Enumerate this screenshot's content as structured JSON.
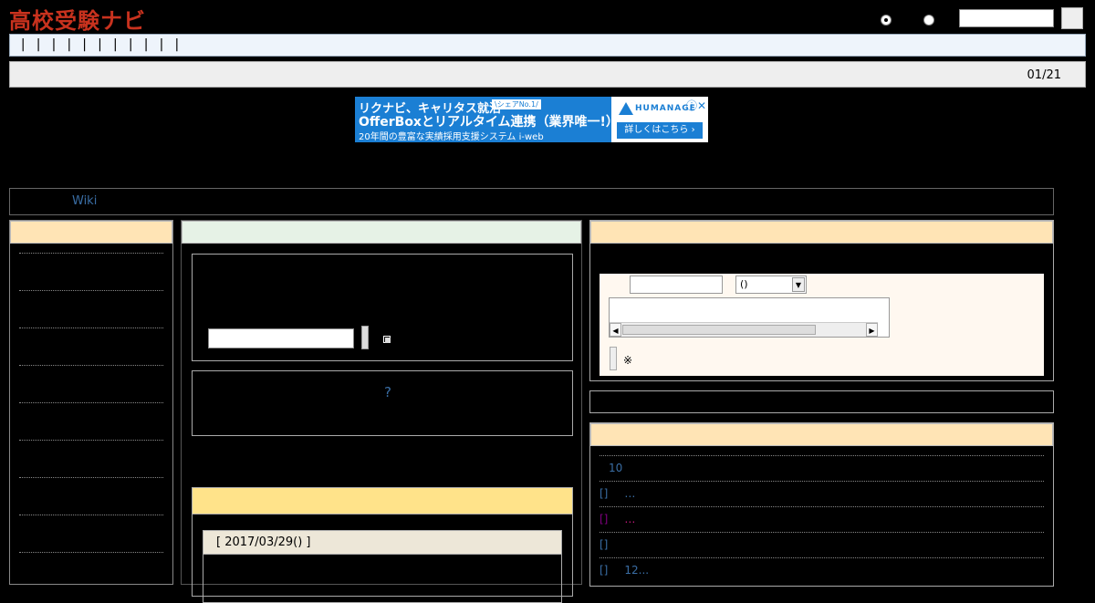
{
  "header": {
    "logo_text": "高校受験ナビ",
    "search_placeholder": ""
  },
  "nav": {
    "items_text": "| | | | | | | | | | |"
  },
  "date_bar": {
    "date": "01/21"
  },
  "ad": {
    "line1": "リクナビ、キャリタス就活",
    "badge": "\\シェアNo.1/",
    "line2": "OfferBoxとリアルタイム連携（業界唯一!）",
    "line3": "20年間の豊富な実績採用支援システム i-web",
    "brand_name": "HUMANAGE",
    "cta": "詳しくはこちら ›",
    "close": "ⓘ✕"
  },
  "breadcrumb": {
    "wiki_link": "Wiki"
  },
  "center": {
    "question_link": "?",
    "news_date": "[ 2017/03/29() ]"
  },
  "right_form": {
    "select_value": "()",
    "note": "※"
  },
  "right_list": {
    "items": [
      {
        "label": "10",
        "sub": ""
      },
      {
        "label": "[]",
        "sub": "…"
      },
      {
        "label": "[]",
        "sub": "…"
      },
      {
        "label": "[]",
        "sub": ""
      },
      {
        "label": "[]",
        "sub": "12..."
      }
    ]
  },
  "colors": {
    "logo": "#c8321e",
    "link": "#3a6ea5",
    "panel_head": "#ffe4b5",
    "mid_head": "#e6f2e6",
    "news_head": "#ffe38a"
  }
}
